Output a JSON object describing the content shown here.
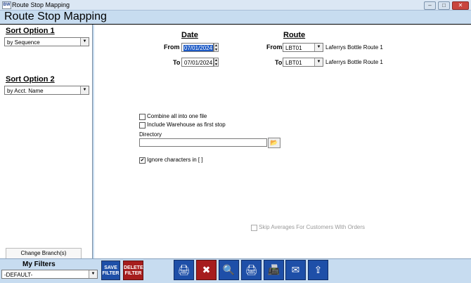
{
  "window": {
    "title": "Route Stop Mapping",
    "minimize": "–",
    "maximize": "□",
    "close": "✕"
  },
  "page": {
    "title": "Route Stop Mapping"
  },
  "left": {
    "sort_option_1_label": "Sort Option 1",
    "sort_option_1_value": "by Sequence",
    "sort_option_2_label": "Sort Option 2",
    "sort_option_2_value": "by Acct. Name",
    "change_branch": "Change Branch(s)"
  },
  "date": {
    "heading": "Date",
    "from_label": "From",
    "from_value": "07/01/2024",
    "to_label": "To",
    "to_value": "07/01/2024"
  },
  "route": {
    "heading": "Route",
    "from_label": "From",
    "from_value": "LBT01",
    "from_desc": "Laferrys Bottle Route 1",
    "to_label": "To",
    "to_value": "LBT01",
    "to_desc": "Laferrys Bottle Route 1"
  },
  "options": {
    "combine": "Combine all into one file",
    "include_warehouse": "Include Warehouse as first stop",
    "directory_label": "Directory",
    "directory_value": "",
    "ignore_chars": "Ignore characters in [ ]",
    "skip_averages": "Skip Averages For Customers With Orders"
  },
  "footer": {
    "my_filters": "My Filters",
    "filter_value": "-DEFAULT-",
    "save_filter": "SAVE FILTER",
    "delete_filter": "DELETE FILTER"
  },
  "icons": {
    "print": "🖨",
    "cancel": "✖",
    "search": "🔍",
    "print_preview": "🖨",
    "fax": "📠",
    "email": "✉",
    "export": "⇪"
  },
  "colors": {
    "accent_blue": "#1e4fa8",
    "delete_red": "#a61d1d",
    "background": "#c7dcf0"
  }
}
